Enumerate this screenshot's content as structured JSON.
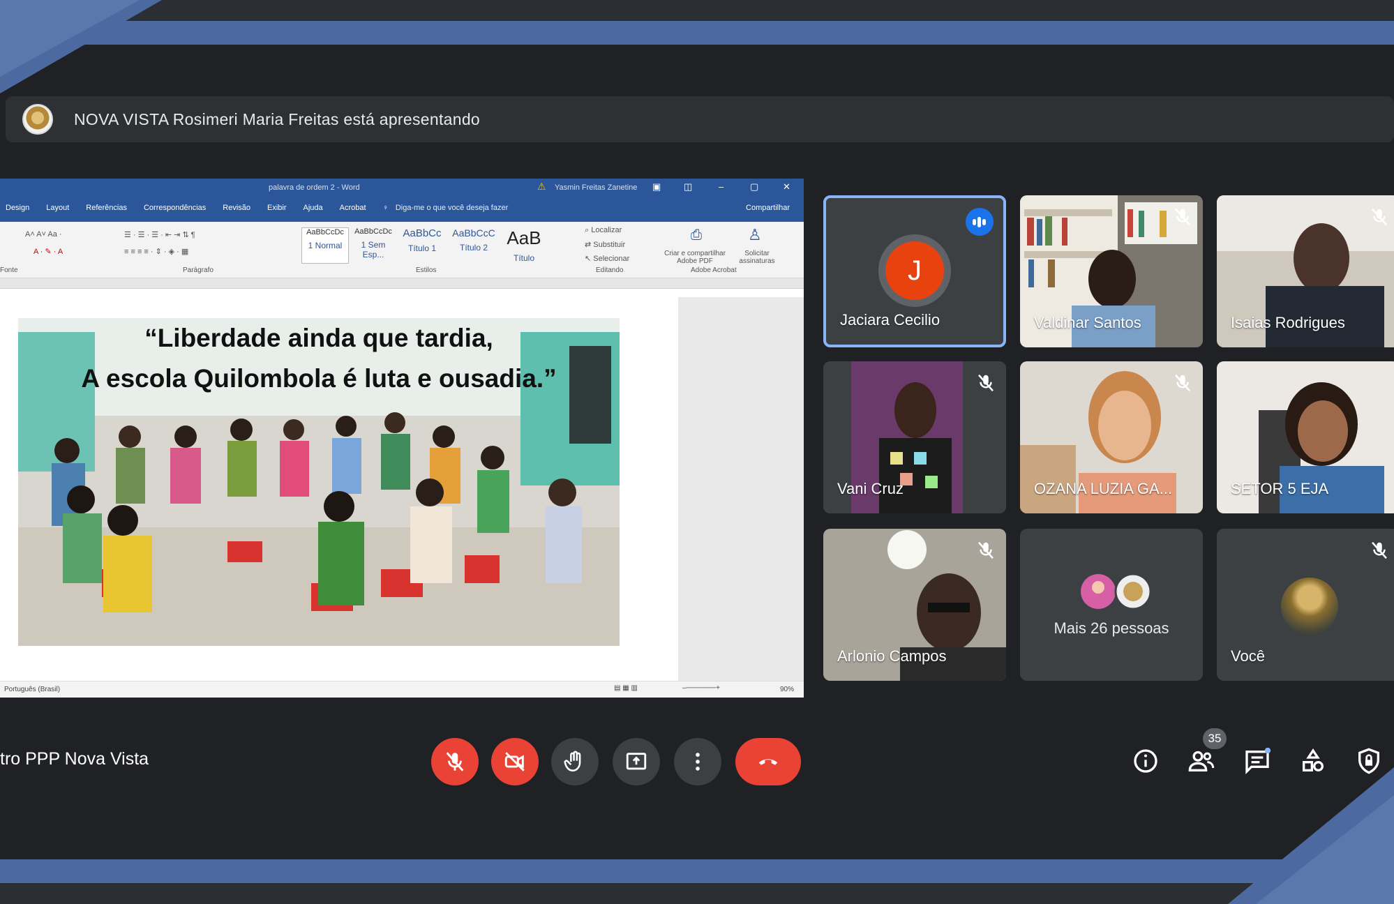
{
  "presenter": {
    "text": "NOVA VISTA Rosimeri Maria Freitas está apresentando"
  },
  "shared_screen": {
    "window_title": "palavra de ordem 2 - Word",
    "user_name": "Yasmin Freitas Zanetine",
    "menu": [
      "Design",
      "Layout",
      "Referências",
      "Correspondências",
      "Revisão",
      "Exibir",
      "Ajuda",
      "Acrobat"
    ],
    "tell_me": "Diga-me o que você deseja fazer",
    "share_label": "Compartilhar",
    "styles": [
      {
        "sample": "AaBbCcDc",
        "name": "1 Normal"
      },
      {
        "sample": "AaBbCcDc",
        "name": "1 Sem Esp..."
      },
      {
        "sample": "AaBbCc",
        "name": "Título 1"
      },
      {
        "sample": "AaBbCcC",
        "name": "Título 2"
      },
      {
        "sample": "AaB",
        "name": "Título"
      }
    ],
    "editing": [
      "Localizar",
      "Substituir",
      "Selecionar"
    ],
    "acrobat_tools": [
      "Criar e compartilhar Adobe PDF",
      "Solicitar assinaturas"
    ],
    "group_labels": [
      "Fonte",
      "Parágrafo",
      "Estilos",
      "Editando",
      "Adobe Acrobat"
    ],
    "slide_line1": "“Liberdade ainda que tardia,",
    "slide_line2": "A escola Quilombola é luta e ousadia.”",
    "status_language": "Português (Brasil)",
    "zoom": "90%"
  },
  "participants": [
    {
      "name": "Jaciara Cecilio",
      "initial": "J",
      "speaking": true
    },
    {
      "name": "Valdinar Santos",
      "muted": true
    },
    {
      "name": "Isaias Rodrigues",
      "muted": true
    },
    {
      "name": "Vani Cruz",
      "muted": true
    },
    {
      "name": "OZANA LUZIA GA...",
      "muted": true
    },
    {
      "name": "SETOR 5 EJA",
      "muted": false
    },
    {
      "name": "Arlonio Campos",
      "muted": true
    },
    {
      "name": "Mais 26 pessoas"
    },
    {
      "name": "Você",
      "muted": true
    }
  ],
  "meeting": {
    "name": "tro PPP Nova Vista"
  },
  "controls": [
    "mic-off-icon",
    "camera-off-icon",
    "raise-hand-icon",
    "present-icon",
    "more-options-icon",
    "end-call-icon"
  ],
  "right_controls": {
    "people_count": "35",
    "icons": [
      "info-icon",
      "people-icon",
      "chat-icon",
      "activities-icon",
      "host-controls-icon"
    ]
  },
  "colors": {
    "accent_band": "#4c6aa0",
    "background": "#202124",
    "tile": "#3c4043",
    "red": "#ea4335",
    "speaking_blue": "#1a73e8",
    "active_border": "#8ab4f8"
  }
}
